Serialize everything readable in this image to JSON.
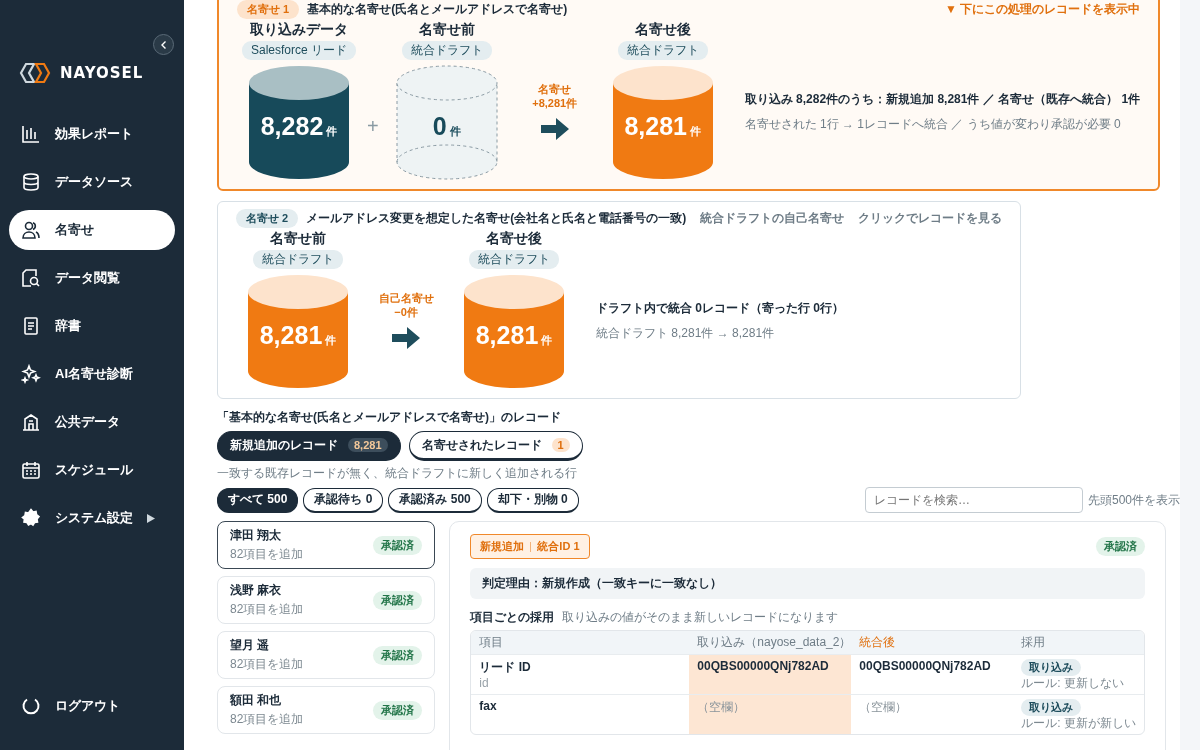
{
  "sidebar": {
    "logo": "NAYOSEL",
    "items": [
      {
        "label": "効果レポート",
        "selected": false,
        "submenu": false
      },
      {
        "label": "データソース",
        "selected": false,
        "submenu": false
      },
      {
        "label": "名寄せ",
        "selected": true,
        "submenu": false
      },
      {
        "label": "データ閲覧",
        "selected": false,
        "submenu": false
      },
      {
        "label": "辞書",
        "selected": false,
        "submenu": false
      },
      {
        "label": "AI名寄せ診断",
        "selected": false,
        "submenu": false
      },
      {
        "label": "公共データ",
        "selected": false,
        "submenu": false
      },
      {
        "label": "スケジュール",
        "selected": false,
        "submenu": false
      },
      {
        "label": "システム設定",
        "selected": false,
        "submenu": true
      }
    ],
    "logout": "ログアウト"
  },
  "merge_steps": [
    {
      "badge": "名寄せ 1",
      "title": "基本的な名寄せ(氏名とメールアドレスで名寄せ)",
      "selected": true,
      "notes": [
        "▼ 下にこの処理のレコードを表示中"
      ],
      "flow": [
        {
          "kind": "source",
          "title": "取り込みデータ",
          "source": "Salesforce リード",
          "count": "8,282",
          "unit": "件"
        },
        {
          "kind": "plus",
          "label": "+"
        },
        {
          "kind": "empty",
          "title": "名寄せ前",
          "source": "統合ドラフト",
          "count": "0",
          "unit": "件"
        },
        {
          "kind": "arrow",
          "lines": [
            "名寄せ",
            "+8,281件"
          ]
        },
        {
          "kind": "merged",
          "title": "名寄せ後",
          "source": "統合ドラフト",
          "count": "8,281",
          "unit": "件"
        }
      ],
      "summary": "取り込み 8,282件のうち：新規追加 8,281件 ／ 名寄せ（既存へ統合） 1件",
      "detail": "名寄せされた 1行 → 1レコードへ統合 ／ うち値が変わり承認が必要 0"
    },
    {
      "badge": "名寄せ 2",
      "title": "メールアドレス変更を想定した名寄せ(会社名と氏名と電話番号の一致)",
      "selected": false,
      "notes": [
        "統合ドラフトの自己名寄せ",
        "クリックでレコードを見る"
      ],
      "flow": [
        {
          "kind": "merged",
          "title": "名寄せ前",
          "source": "統合ドラフト",
          "count": "8,281",
          "unit": "件"
        },
        {
          "kind": "arrow",
          "lines": [
            "自己名寄せ",
            "−0件"
          ]
        },
        {
          "kind": "merged",
          "title": "名寄せ後",
          "source": "統合ドラフト",
          "count": "8,281",
          "unit": "件"
        }
      ],
      "summary": "ドラフト内で統合 0レコード（寄った行 0行）",
      "detail": "統合ドラフト 8,281件 → 8,281件"
    }
  ],
  "records": {
    "heading": "「基本的な名寄せ(氏名とメールアドレスで名寄せ)」のレコード",
    "tabs": [
      {
        "label": "新規追加のレコード",
        "count": "8,281",
        "selected": true
      },
      {
        "label": "名寄せされたレコード",
        "count": "1",
        "selected": false
      }
    ],
    "tab_hint": "一致する既存レコードが無く、統合ドラフトに新しく追加される行",
    "filters": [
      {
        "label": "すべて 500",
        "selected": true
      },
      {
        "label": "承認待ち 0",
        "selected": false
      },
      {
        "label": "承認済み 500",
        "selected": false
      },
      {
        "label": "却下・別物 0",
        "selected": false
      }
    ],
    "search": {
      "placeholder": "レコードを検索…"
    },
    "limit_note": "先頭500件を表示",
    "list": [
      {
        "name": "津田 翔太",
        "sub": "82項目を追加",
        "status": "承認済",
        "selected": true
      },
      {
        "name": "浅野 麻衣",
        "sub": "82項目を追加",
        "status": "承認済",
        "selected": false
      },
      {
        "name": "望月 遥",
        "sub": "82項目を追加",
        "status": "承認済",
        "selected": false
      },
      {
        "name": "額田 和也",
        "sub": "82項目を追加",
        "status": "承認済",
        "selected": false
      }
    ],
    "detail": {
      "tag": [
        "新規追加",
        "統合ID 1"
      ],
      "status": "承認済",
      "reason": "判定理由：新規作成（一致キーに一致なし）",
      "fields_heading": "項目ごとの採用",
      "fields_hint": "取り込みの値がそのまま新しいレコードになります",
      "columns": [
        "項目",
        "取り込み（nayose_data_2）",
        "統合後",
        "採用"
      ],
      "rows": [
        {
          "label": "リード ID",
          "key": "id",
          "import": "00QBS00000QNj782AD",
          "import_blank": false,
          "merged": "00QBS00000QNj782AD",
          "merged_blank": false,
          "adopt": "取り込み",
          "rule": "ルール: 更新しない"
        },
        {
          "label": "fax",
          "import": "（空欄）",
          "import_blank": true,
          "merged": "（空欄）",
          "merged_blank": true,
          "adopt": "取り込み",
          "rule": "ルール: 更新が新しい"
        }
      ]
    }
  }
}
